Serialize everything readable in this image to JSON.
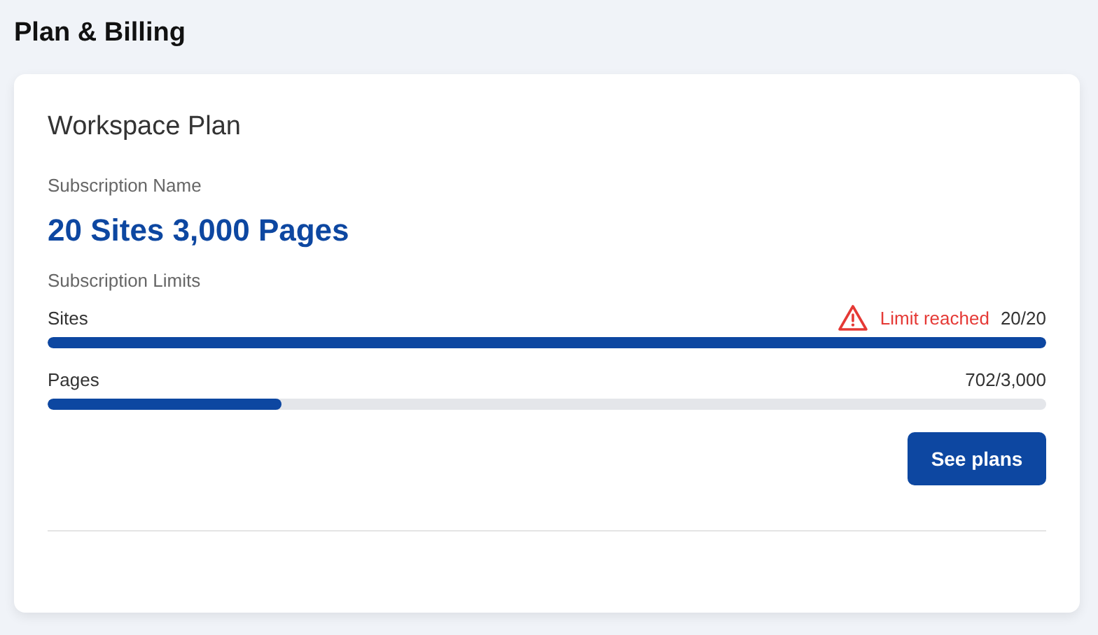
{
  "page_title": "Plan & Billing",
  "card": {
    "title": "Workspace Plan",
    "subscription_label": "Subscription Name",
    "subscription_name": "20 Sites 3,000 Pages",
    "limits_label": "Subscription Limits",
    "limits": [
      {
        "name": "Sites",
        "warning": "Limit reached",
        "reading": "20/20",
        "level": 1
      },
      {
        "name": "Pages",
        "reading": "702/3,000",
        "level": 0.234
      }
    ],
    "button": "See plans"
  }
}
